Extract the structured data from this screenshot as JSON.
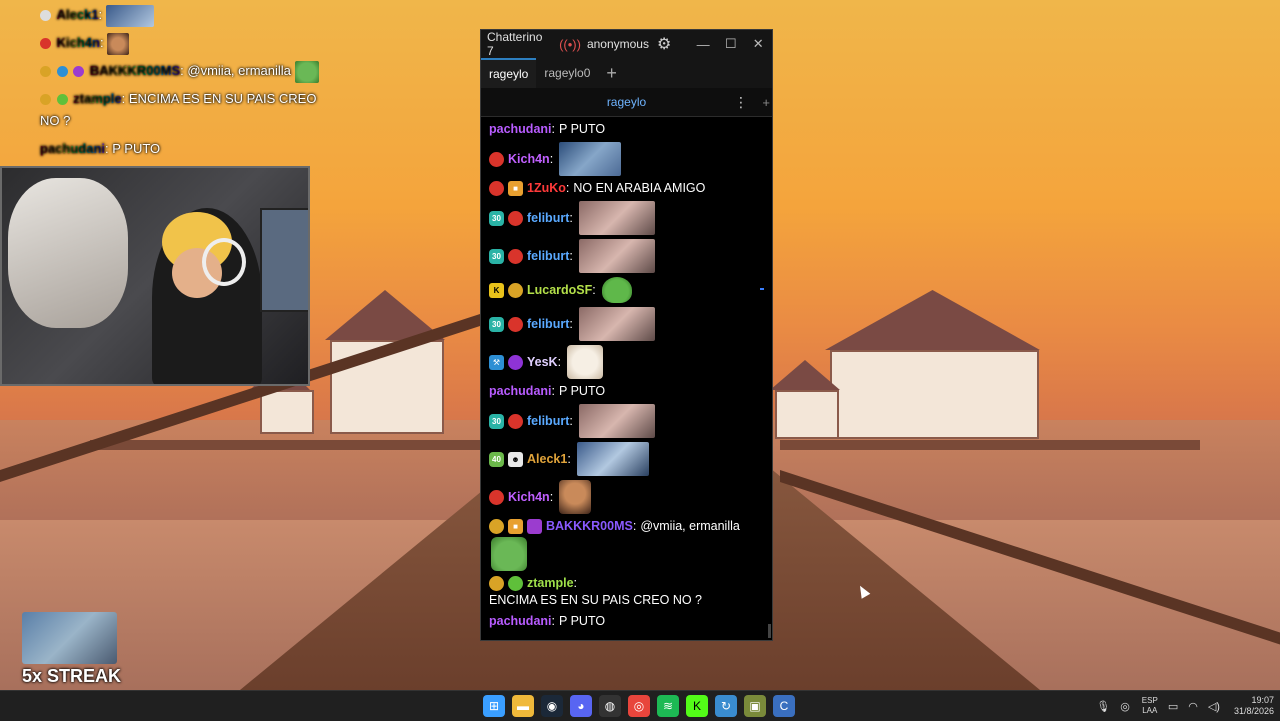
{
  "overlay_chat": [
    {
      "user": "Aleck1",
      "text": ":",
      "emote": true
    },
    {
      "user": "Kich4n",
      "text": ":",
      "emote": true
    },
    {
      "user": "BAKKKR00MS",
      "text": ": @vmiia, ermanilla",
      "emote": true
    },
    {
      "user": "ztample",
      "text": ": ENCIMA ES EN SU PAIS CREO",
      "cont": "NO ?"
    },
    {
      "user": "pachudani",
      "text": ": P PUTO"
    }
  ],
  "streak": {
    "label": "5x STREAK"
  },
  "window": {
    "app_title": "Chatterino 7",
    "user": "anonymous",
    "signal_icon": "broadcast-icon",
    "gear_icon": "gear-icon",
    "controls": {
      "minimize": "—",
      "maximize": "☐",
      "close": "✕"
    },
    "tabs": [
      {
        "label": "rageylo",
        "active": true
      },
      {
        "label": "rageylo0",
        "active": false
      }
    ],
    "add_tab": "+",
    "split_channel": "rageylo",
    "split_menu": "⋮",
    "split_add": "+"
  },
  "messages": [
    {
      "user": "pachudani",
      "color": "#b85cff",
      "badges": [],
      "text": "P PUTO",
      "emote": null
    },
    {
      "user": "Kich4n",
      "color": "#c060ff",
      "badges": [
        "red"
      ],
      "text": "",
      "emote": "blue"
    },
    {
      "user": "1ZuKo",
      "color": "#ff3a3a",
      "badges": [
        "red",
        "box"
      ],
      "text": "NO EN ARABIA AMIGO",
      "emote": null
    },
    {
      "user": "feliburt",
      "color": "#5aa9ff",
      "badges": [
        "sub30",
        "red"
      ],
      "text": "",
      "emote": "pink"
    },
    {
      "user": "feliburt",
      "color": "#5aa9ff",
      "badges": [
        "sub30",
        "red"
      ],
      "text": "",
      "emote": "pink"
    },
    {
      "user": "LucardoSF",
      "color": "#b4e04a",
      "badges": [
        "k",
        "gold"
      ],
      "text": "",
      "emote": "frog"
    },
    {
      "user": "feliburt",
      "color": "#5aa9ff",
      "badges": [
        "sub30",
        "red"
      ],
      "text": "",
      "emote": "pink"
    },
    {
      "user": "YesK",
      "color": "#e0d0ff",
      "badges": [
        "mod",
        "pink"
      ],
      "text": "",
      "emote": "cat"
    },
    {
      "user": "pachudani",
      "color": "#b85cff",
      "badges": [],
      "text": "P PUTO",
      "emote": null
    },
    {
      "user": "feliburt",
      "color": "#5aa9ff",
      "badges": [
        "sub30",
        "red"
      ],
      "text": "",
      "emote": "pink"
    },
    {
      "user": "Aleck1",
      "color": "#e0a33a",
      "badges": [
        "cheer40",
        "ghost"
      ],
      "text": "",
      "emote": "alec"
    },
    {
      "user": "Kich4n",
      "color": "#c060ff",
      "badges": [
        "red"
      ],
      "text": "",
      "emote": "face"
    },
    {
      "user": "BAKKKR00MS",
      "color": "#8a5aff",
      "badges": [
        "gold",
        "box",
        "purple"
      ],
      "text": "@vmiia, ermanilla",
      "emote": "frog2"
    },
    {
      "user": "ztample",
      "color": "#9fe04a",
      "badges": [
        "gold",
        "alien"
      ],
      "text": "ENCIMA ES EN SU PAIS CREO NO ?",
      "emote": null
    },
    {
      "user": "pachudani",
      "color": "#b85cff",
      "badges": [],
      "text": "P PUTO",
      "emote": null
    }
  ],
  "badge_labels": {
    "sub30": "30",
    "cheer40": "40",
    "k": "K",
    "ghost": "☻",
    "mod": "⚒",
    "box": "■"
  },
  "taskbar": {
    "apps": [
      "start-icon",
      "folder-icon",
      "steam-icon",
      "discord-icon",
      "obs-icon",
      "chrome-icon",
      "spotify-icon",
      "kick-icon",
      "refresh-app-icon",
      "media-app-icon",
      "chatterino-icon"
    ],
    "lang_top": "ESP",
    "lang_bottom": "LAA",
    "time": "19:07",
    "date": "31/8/2026"
  }
}
